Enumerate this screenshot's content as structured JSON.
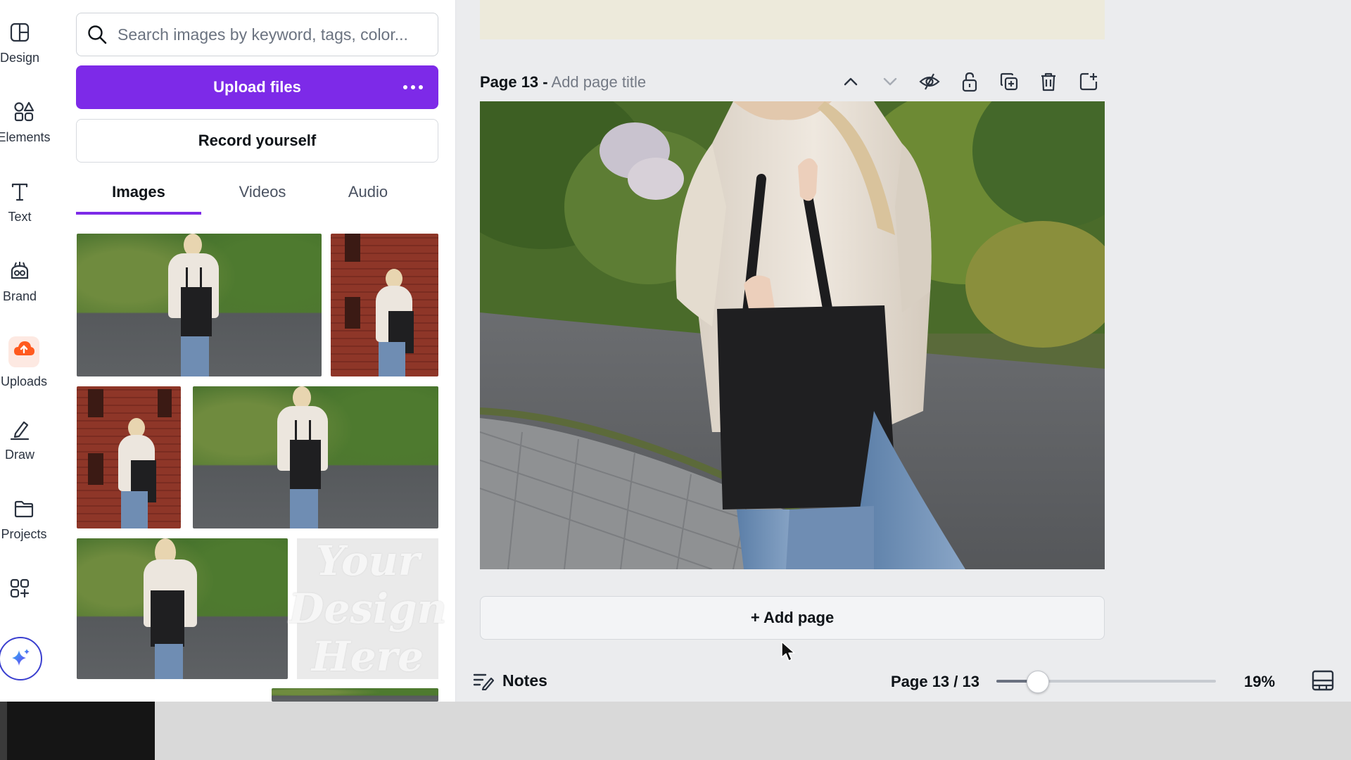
{
  "sidebar": {
    "items": [
      {
        "label": "Design",
        "icon": "layout-icon"
      },
      {
        "label": "Elements",
        "icon": "shapes-icon"
      },
      {
        "label": "Text",
        "icon": "text-icon"
      },
      {
        "label": "Brand",
        "icon": "brand-icon"
      },
      {
        "label": "Uploads",
        "icon": "upload-cloud-icon"
      },
      {
        "label": "Draw",
        "icon": "pen-icon"
      },
      {
        "label": "Projects",
        "icon": "folder-icon"
      },
      {
        "label": "",
        "icon": "apps-icon"
      }
    ],
    "accent_color": "#ff5a1f"
  },
  "panel": {
    "search_placeholder": "Search images by keyword, tags, color...",
    "upload_label": "Upload files",
    "record_label": "Record yourself",
    "tabs": [
      {
        "label": "Images",
        "active": true
      },
      {
        "label": "Videos",
        "active": false
      },
      {
        "label": "Audio",
        "active": false
      }
    ],
    "design_thumb_lines": [
      "Your",
      "Design",
      "Here"
    ]
  },
  "editor": {
    "page_label": "Page 13 -",
    "page_title_placeholder": "Add page title",
    "add_page_label": "+ Add page"
  },
  "footer": {
    "notes_label": "Notes",
    "page_count": "Page 13 / 13",
    "zoom_value": "19%",
    "zoom_level": 0.19
  },
  "colors": {
    "brand_purple": "#7d2ae8",
    "magic_ring": "#3a3fcf"
  }
}
